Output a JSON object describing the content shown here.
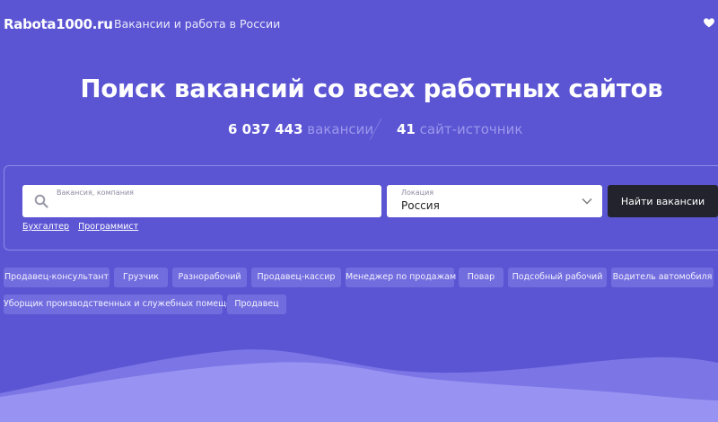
{
  "header": {
    "logo": "Rabota1000.ru",
    "tagline": "Вакансии и работа в России",
    "favorite_icon": "heart-icon"
  },
  "hero": {
    "title": "Поиск вакансий со всех работных сайтов",
    "vacancies_count": "6 037 443",
    "vacancies_word": "вакансии",
    "sources_count": "41",
    "sources_word": "сайт-источник"
  },
  "search": {
    "query_label": "Вакансия, компания",
    "query_value": "",
    "search_icon": "search-icon",
    "location_label": "Локация",
    "location_value": "Россия",
    "location_icon": "chevron-down-icon",
    "button_label": "Найти вакансии",
    "quick_links": [
      "Бухгалтер",
      "Программист"
    ]
  },
  "popular_jobs": [
    "Продавец-консультант",
    "Грузчик",
    "Разнорабочий",
    "Продавец-кассир",
    "Менеджер по продажам",
    "Повар",
    "Подсобный рабочий",
    "Водитель автомобиля",
    "Уборщик производственных и служебных помещений",
    "Продавец"
  ],
  "colors": {
    "background": "#5b55d3",
    "chip": "#726dde",
    "button": "#23232d",
    "muted_text": "#9c98ec",
    "wave_light": "#9893f2",
    "wave_dark": "#7b75e6"
  }
}
